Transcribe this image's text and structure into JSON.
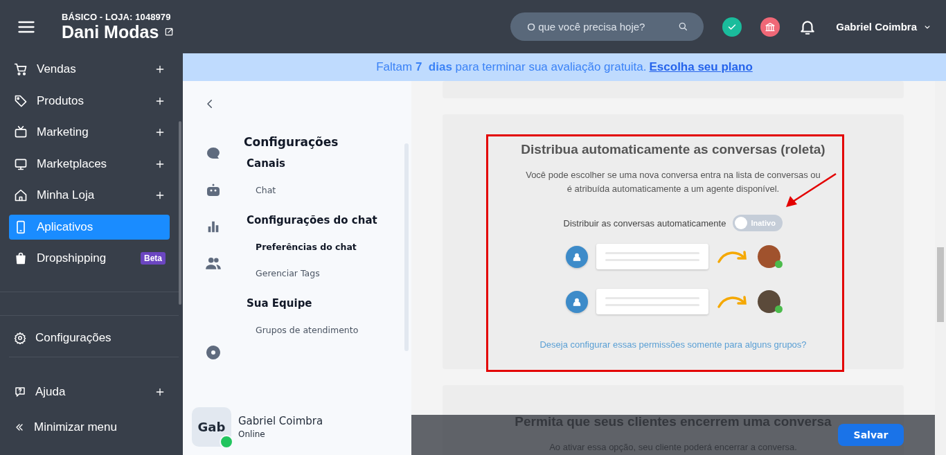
{
  "header": {
    "plan": "BÁSICO - LOJA: 1048979",
    "store_name": "Dani Modas",
    "search": {
      "placeholder": "O que você precisa hoje?"
    },
    "user_name": "Gabriel Coimbra"
  },
  "banner": {
    "text": "Faltam **7  dias** para terminar sua avaliação gratuita.",
    "link": "Escolha seu plano"
  },
  "sidebar": {
    "items": [
      {
        "label": "Vendas",
        "expandable": true,
        "selected": false
      },
      {
        "label": "Produtos",
        "expandable": true,
        "selected": false
      },
      {
        "label": "Marketing",
        "expandable": true,
        "selected": false
      },
      {
        "label": "Marketplaces",
        "expandable": true,
        "selected": false
      },
      {
        "label": "Minha Loja",
        "expandable": true,
        "selected": false
      },
      {
        "label": "Aplicativos",
        "expandable": false,
        "selected": true
      },
      {
        "label": "Dropshipping",
        "expandable": false,
        "selected": false,
        "badge": "Beta"
      }
    ],
    "footer_items": [
      {
        "label": "Configurações",
        "expandable": false
      },
      {
        "label": "Ajuda",
        "expandable": true
      }
    ],
    "minimize": "Minimizar menu"
  },
  "config_panel": {
    "title": "Configurações",
    "sections": [
      {
        "heading": "Canais",
        "items": [
          {
            "label": "Chat",
            "selected": false
          }
        ]
      },
      {
        "heading": "Configurações do chat",
        "items": [
          {
            "label": "Preferências do chat",
            "selected": true
          },
          {
            "label": "Gerenciar Tags",
            "selected": false
          }
        ]
      },
      {
        "heading": "Sua Equipe",
        "items": [
          {
            "label": "Grupos de atendimento",
            "selected": false
          }
        ]
      }
    ],
    "user": {
      "initials": "Gab",
      "name": "Gabriel Coimbra",
      "status": "Online"
    }
  },
  "content": {
    "cards": [
      {
        "heading": "Distribua automaticamente as conversas (roleta)",
        "description": "Você pode escolher se uma nova conversa entra na lista de conversas ou é atribuída automaticamente a um agente disponível.",
        "toggle": {
          "label": "Distribuir as conversas automaticamente",
          "on": false,
          "text": "Inativo"
        },
        "link": "Deseja configurar essas permissões somente para alguns grupos?"
      },
      {
        "heading": "Permita que seus clientes encerrem uma conversa",
        "description": "Ao ativar essa opção, seu cliente poderá encerrar a conversa."
      }
    ]
  },
  "save_button": "Salvar"
}
